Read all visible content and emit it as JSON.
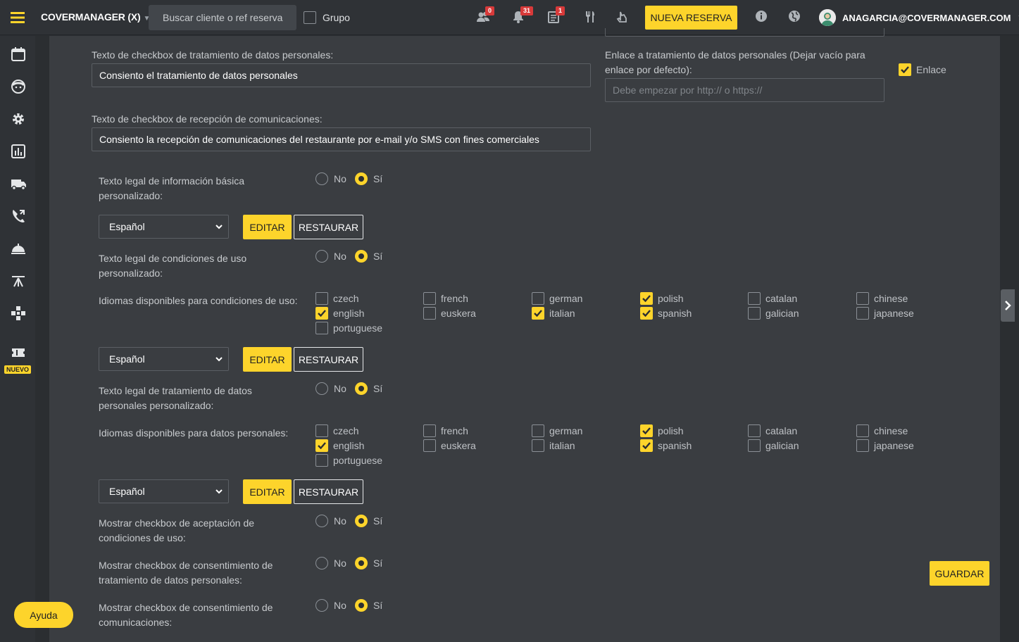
{
  "topbar": {
    "brand": "COVERMANAGER (X)",
    "search_placeholder": "Buscar cliente o ref reserva",
    "group_label": "Grupo",
    "badges": {
      "people": "0",
      "notifications": "31",
      "reservations": "1"
    },
    "new_reservation": "NUEVA RESERVA",
    "user_email": "ANAGARCIA@COVERMANAGER.COM"
  },
  "sidebar": {
    "new_badge": "NUEVO"
  },
  "form": {
    "privacy_checkbox_text_label": "Texto de checkbox de tratamiento de datos personales:",
    "privacy_checkbox_text_value": "Consiento el tratamiento de datos personales",
    "privacy_link_label": "Enlace a tratamiento de datos personales (Dejar vacío para enlace por defecto):",
    "privacy_link_placeholder": "Debe empezar por http:// o https://",
    "link_checkbox_label": "Enlace",
    "comms_checkbox_text_label": "Texto de checkbox de recepción de comunicaciones:",
    "comms_checkbox_text_value": "Consiento la recepción de comunicaciones del restaurante por e-mail y/o SMS con fines comerciales",
    "radio_no": "No",
    "radio_si": "Sí",
    "basic_info_label": "Texto legal de información básica personalizado:",
    "terms_label": "Texto legal de condiciones de uso personalizado:",
    "terms_languages_label": "Idiomas disponibles para condiciones de uso:",
    "privacy_text_label": "Texto legal de tratamiento de datos personales personalizado:",
    "privacy_languages_label": "Idiomas disponibles para datos personales:",
    "show_terms_label": "Mostrar checkbox de aceptación de condiciones de uso:",
    "show_privacy_label": "Mostrar checkbox de consentimiento de tratamiento de datos personales:",
    "show_comms_label": "Mostrar checkbox de consentimiento de comunicaciones:",
    "language_select": "Español",
    "edit_button": "EDITAR",
    "restore_button": "RESTAURAR",
    "save_button": "GUARDAR"
  },
  "terms_languages": [
    {
      "name": "czech",
      "checked": false
    },
    {
      "name": "french",
      "checked": false
    },
    {
      "name": "german",
      "checked": false
    },
    {
      "name": "polish",
      "checked": true
    },
    {
      "name": "catalan",
      "checked": false
    },
    {
      "name": "chinese",
      "checked": false
    },
    {
      "name": "english",
      "checked": true
    },
    {
      "name": "euskera",
      "checked": false
    },
    {
      "name": "italian",
      "checked": true
    },
    {
      "name": "spanish",
      "checked": true
    },
    {
      "name": "galician",
      "checked": false
    },
    {
      "name": "japanese",
      "checked": false
    },
    {
      "name": "portuguese",
      "checked": false
    }
  ],
  "privacy_languages": [
    {
      "name": "czech",
      "checked": false
    },
    {
      "name": "french",
      "checked": false
    },
    {
      "name": "german",
      "checked": false
    },
    {
      "name": "polish",
      "checked": true
    },
    {
      "name": "catalan",
      "checked": false
    },
    {
      "name": "chinese",
      "checked": false
    },
    {
      "name": "english",
      "checked": true
    },
    {
      "name": "euskera",
      "checked": false
    },
    {
      "name": "italian",
      "checked": false
    },
    {
      "name": "spanish",
      "checked": true
    },
    {
      "name": "galician",
      "checked": false
    },
    {
      "name": "japanese",
      "checked": false
    },
    {
      "name": "portuguese",
      "checked": false
    }
  ],
  "help_button": "Ayuda"
}
